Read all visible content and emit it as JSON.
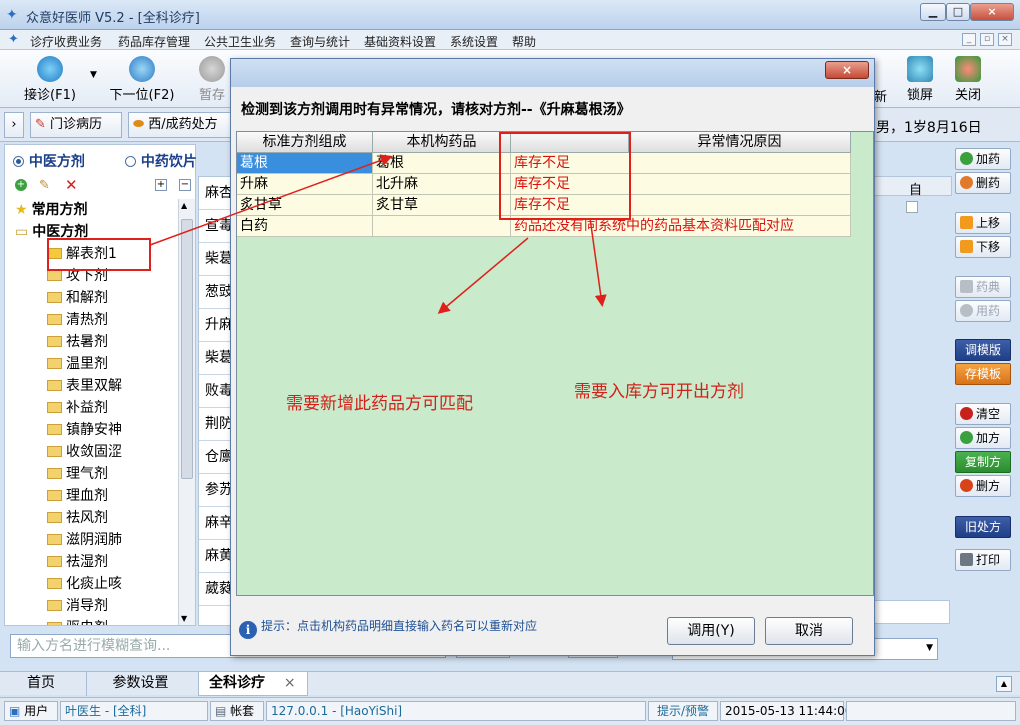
{
  "window": {
    "title": "众意好医师 V5.2 - [全科诊疗]",
    "min": "0",
    "max": "□",
    "close": "×"
  },
  "menu": [
    "诊疗收费业务",
    "药品库存管理",
    "公共卫生业务",
    "查询与统计",
    "基础资料设置",
    "系统设置",
    "帮助"
  ],
  "toolbar": {
    "reception": "接诊(F1)",
    "next": "下一位(F2)",
    "pause": "暂存",
    "refresh_partial": "新",
    "lock": "锁屏",
    "close": "关闭"
  },
  "tabs": {
    "clinic_record": "门诊病历",
    "western_rx": "西/成药处方",
    "patient_info": "，男，1岁8月16日"
  },
  "left": {
    "radio_tcm_formula": "中医方剂",
    "radio_tcm_pieces": "中药饮片",
    "tree": [
      {
        "label": "常用方剂",
        "level": 0
      },
      {
        "label": "中医方剂",
        "level": 0
      },
      {
        "label": "解表剂1",
        "level": 1
      },
      {
        "label": "攻下剂",
        "level": 1
      },
      {
        "label": "和解剂",
        "level": 1
      },
      {
        "label": "清热剂",
        "level": 1
      },
      {
        "label": "祛暑剂",
        "level": 1
      },
      {
        "label": "温里剂",
        "level": 1
      },
      {
        "label": "表里双解",
        "level": 1
      },
      {
        "label": "补益剂",
        "level": 1
      },
      {
        "label": "镇静安神",
        "level": 1
      },
      {
        "label": "收敛固涩",
        "level": 1
      },
      {
        "label": "理气剂",
        "level": 1
      },
      {
        "label": "理血剂",
        "level": 1
      },
      {
        "label": "祛风剂",
        "level": 1
      },
      {
        "label": "滋阴润肺",
        "level": 1
      },
      {
        "label": "祛湿剂",
        "level": 1
      },
      {
        "label": "化痰止咳",
        "level": 1
      },
      {
        "label": "消导剂",
        "level": 1
      },
      {
        "label": "驱虫剂",
        "level": 1
      }
    ],
    "search_placeholder": "输入方名进行模糊查询..."
  },
  "midlist": [
    "麻杏",
    "宣毒",
    "柴葛",
    "葱豉",
    "升麻",
    "柴葛",
    "败毒",
    "荆防",
    "仓廪",
    "参苏",
    "麻辛",
    "麻黄",
    "葳蕤"
  ],
  "right_header": {
    "col_self": "自"
  },
  "sidebar": {
    "add_drug": "加药",
    "del_drug": "删药",
    "move_up": "上移",
    "move_down": "下移",
    "pharmacopoeia": "药典",
    "usage": "用药",
    "adjust_template": "调模版",
    "save_template": "存模板",
    "clear": "清空",
    "add_rx": "加方",
    "copy_rx": "复制方",
    "delete_rx": "删方",
    "old_rx": "旧处方",
    "print": "打印"
  },
  "dialog": {
    "close": "×",
    "heading": "检测到该方剂调用时有异常情况，请核对方剂--《升麻葛根汤》",
    "columns": [
      "标准方剂组成",
      "本机构药品",
      "",
      "异常情况原因"
    ],
    "rows": [
      {
        "std": "葛根",
        "local": "葛根",
        "reason": "库存不足"
      },
      {
        "std": "升麻",
        "local": "北升麻",
        "reason": "库存不足"
      },
      {
        "std": "炙甘草",
        "local": "炙甘草",
        "reason": "库存不足"
      },
      {
        "std": "白药",
        "local": "",
        "reason": "药品还没有同系统中的药品基本资料匹配对应"
      }
    ],
    "annotation_left": "需要新增此药品方可匹配",
    "annotation_right": "需要入库方可开出方剂",
    "hint": "提示：点击机构药品明细直接输入药名可以重新对应",
    "confirm": "调用(Y)",
    "cancel": "取消"
  },
  "bottom_tabs": {
    "home": "首页",
    "params": "参数设置",
    "general": "全科诊疗",
    "close": "×"
  },
  "status": {
    "user_label": "用户",
    "user": "叶医生 - [全科]",
    "account": "帐套",
    "server": "127.0.0.1 - [HaoYiShi]",
    "alerts": "提示/预警",
    "datetime": "2015-05-13 11:44:00"
  },
  "colors": {
    "dialog_grid_bg": "#c9eacb",
    "annotation_red": "#d0221a",
    "selected_cell": "#3a8ede"
  }
}
